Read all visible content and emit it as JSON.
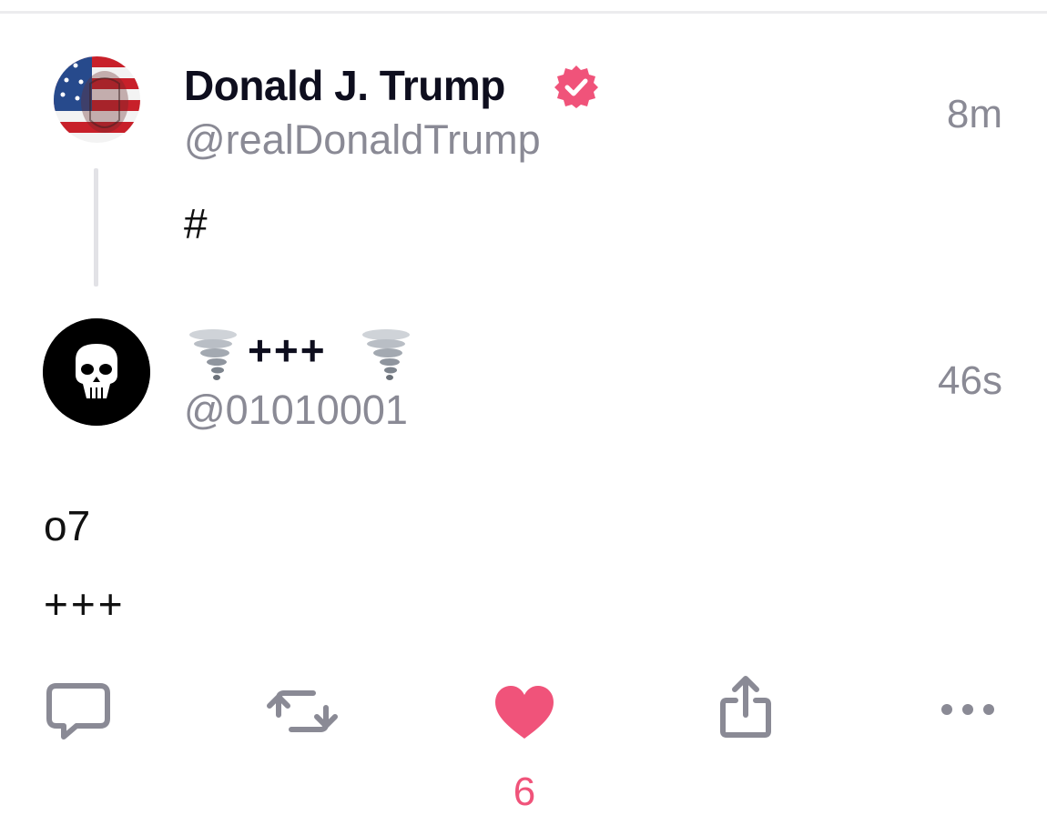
{
  "colors": {
    "accent": "#f0537a",
    "text_primary": "#0e0e1e",
    "text_secondary": "#8a8a95",
    "divider": "#e2e2e6"
  },
  "parent_post": {
    "author_name": "Donald J. Trump",
    "verified": true,
    "handle": "@realDonaldTrump",
    "timestamp": "8m",
    "text": "#",
    "avatar_icon": "flag-portrait-avatar"
  },
  "reply_post": {
    "author_name_text": "+++",
    "name_emoji": "tornado-icon",
    "handle": "@01010001",
    "timestamp": "46s",
    "text_lines": [
      "o7",
      "+++"
    ],
    "avatar_icon": "skull-avatar"
  },
  "actions": {
    "reply_icon": "speech-bubble-icon",
    "repost_icon": "repost-arrows-icon",
    "like_icon": "heart-icon",
    "like_active": true,
    "like_count": "6",
    "share_icon": "share-icon",
    "more_icon": "ellipsis-icon"
  }
}
